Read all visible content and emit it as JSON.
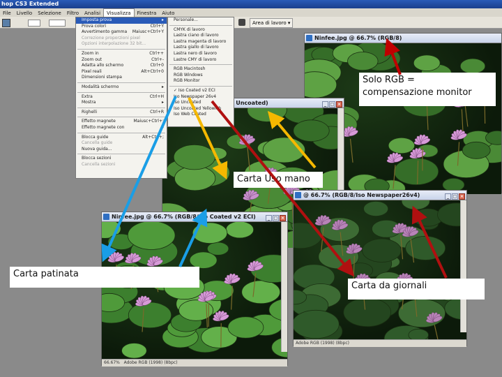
{
  "app": {
    "title": "hop CS3 Extended"
  },
  "menubar": {
    "items": [
      "File",
      "Livello",
      "Selezione",
      "Filtro",
      "Analisi",
      "Visualizza",
      "Finestra",
      "Aiuto"
    ],
    "active_index": 5
  },
  "optbar": {
    "workspace": "Area di lavoro ▾"
  },
  "view_menu": {
    "items": [
      {
        "label": "Imposta prova",
        "sc": "▸",
        "sel": true
      },
      {
        "label": "Prova colori",
        "sc": "Ctrl+Y"
      },
      {
        "label": "Avvertimento gamma",
        "sc": "Maiusc+Ctrl+Y"
      },
      {
        "label": "Correzione proporzioni pixel",
        "sc": "",
        "dim": true
      },
      {
        "label": "Opzioni interpolazione 32 bit...",
        "sc": "",
        "dim": true
      },
      {
        "sep": true
      },
      {
        "label": "Zoom in",
        "sc": "Ctrl++"
      },
      {
        "label": "Zoom out",
        "sc": "Ctrl+-"
      },
      {
        "label": "Adatta allo schermo",
        "sc": "Ctrl+0"
      },
      {
        "label": "Pixel reali",
        "sc": "Alt+Ctrl+0"
      },
      {
        "label": "Dimensioni stampa",
        "sc": ""
      },
      {
        "sep": true
      },
      {
        "label": "Modalità schermo",
        "sc": "▸"
      },
      {
        "sep": true
      },
      {
        "label": "Extra",
        "sc": "Ctrl+H"
      },
      {
        "label": "Mostra",
        "sc": "▸"
      },
      {
        "sep": true
      },
      {
        "label": "Righelli",
        "sc": "Ctrl+R"
      },
      {
        "sep": true
      },
      {
        "label": "Effetto magnete",
        "sc": "Maiusc+Ctrl+;"
      },
      {
        "label": "Effetto magnete con",
        "sc": "▸"
      },
      {
        "sep": true
      },
      {
        "label": "Blocca guide",
        "sc": "Alt+Ctrl+;"
      },
      {
        "label": "Cancella guide",
        "sc": "",
        "dim": true
      },
      {
        "label": "Nuova guida...",
        "sc": ""
      },
      {
        "sep": true
      },
      {
        "label": "Blocca sezioni",
        "sc": ""
      },
      {
        "label": "Cancella sezioni",
        "sc": "",
        "dim": true
      }
    ]
  },
  "proof_submenu": {
    "items": [
      {
        "label": "Personale..."
      },
      {
        "sep": true
      },
      {
        "label": "CMYK di lavoro"
      },
      {
        "label": "Lastra ciano di lavoro"
      },
      {
        "label": "Lastra magenta di lavoro"
      },
      {
        "label": "Lastra giallo di lavoro"
      },
      {
        "label": "Lastra nero di lavoro"
      },
      {
        "label": "Lastre CMY di lavoro"
      },
      {
        "sep": true
      },
      {
        "label": "RGB Macintosh"
      },
      {
        "label": "RGB Windows"
      },
      {
        "label": "RGB Monitor"
      },
      {
        "sep": true
      },
      {
        "label": "✓ Iso Coated v2 ECI"
      },
      {
        "label": "Iso Newspaper 26v4"
      },
      {
        "label": "Iso Uncoated"
      },
      {
        "label": "Iso Uncoated Yellowish"
      },
      {
        "label": "Iso Web Coated"
      }
    ]
  },
  "docs": {
    "top_right": {
      "title": "Ninfee.jpg @ 66.7% (RGB/8)",
      "status": ""
    },
    "middle": {
      "title": "@ 66.7% (RGB/8/Iso Uncoated)",
      "status": ""
    },
    "bottom_left": {
      "title": "Ninfee.jpg @ 66.7% (RGB/8/Iso Coated v2 ECI)",
      "status_zoom": "66.67%",
      "status_doc": "Adobe RGB (1998) (8bpc)"
    },
    "bottom_right": {
      "title": "@ 66.7% (RGB/8/Iso Newspaper26v4)",
      "status_doc": "Adobe RGB (1998) (8bpc)"
    }
  },
  "notes": {
    "rgb": [
      "Solo RGB =",
      "compensazione monitor"
    ],
    "uso_mano": "Carta Uso mano",
    "patinata": "Carta patinata",
    "giornali": "Carta da giornali"
  },
  "arrow_colors": {
    "red": "#c00000",
    "blue": "#1a9ee6",
    "yellow": "#f5b800",
    "dark_red": "#b01010"
  }
}
